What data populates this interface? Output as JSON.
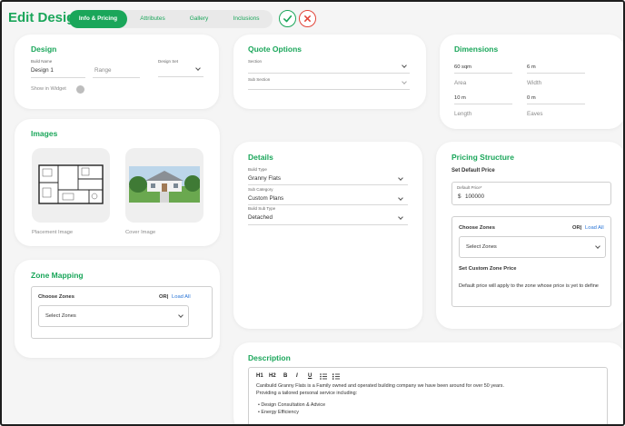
{
  "header": {
    "title": "Edit Design",
    "tabs": [
      "Info & Pricing",
      "Attributes",
      "Gallery",
      "Inclusions"
    ],
    "active_tab": 0
  },
  "design": {
    "title": "Design",
    "build_name_label": "Build Name",
    "build_name_value": "Design 1",
    "range_placeholder": "Range",
    "design_set_label": "Design Set",
    "show_in_widget_label": "Show in Widget"
  },
  "quote_options": {
    "title": "Quote Options",
    "section_placeholder": "Section",
    "sub_section_placeholder": "Sub Section"
  },
  "dimensions": {
    "title": "Dimensions",
    "area_value": "60 sqm",
    "area_label": "Area",
    "width_value": "6 m",
    "width_label": "Width",
    "length_value": "10 m",
    "length_label": "Length",
    "eaves_value": "0 m",
    "eaves_label": "Eaves"
  },
  "images": {
    "title": "Images",
    "placement_label": "Placement Image",
    "cover_label": "Cover Image"
  },
  "details": {
    "title": "Details",
    "build_type_label": "Build Type",
    "build_type_value": "Granny Flats",
    "sub_category_label": "Sub Category",
    "sub_category_value": "Custom Plans",
    "build_sub_type_label": "Build Sub Type",
    "build_sub_type_value": "Detached"
  },
  "pricing": {
    "title": "Pricing Structure",
    "set_default_label": "Set Default Price",
    "default_price_label": "Default Price*",
    "currency": "$",
    "default_price_value": "100000",
    "choose_zones_label": "Choose Zones",
    "or_label": "OR|",
    "load_all_label": "Load All",
    "select_zones_placeholder": "Select Zones",
    "set_custom_label": "Set Custom Zone Price",
    "note": "Default price will apply to the zone whose price is yet to define"
  },
  "zone_mapping": {
    "title": "Zone Mapping",
    "choose_zones_label": "Choose Zones",
    "or_label": "OR|",
    "load_all_label": "Load All",
    "select_zones_placeholder": "Select Zones"
  },
  "description": {
    "title": "Description",
    "toolbar": [
      "H1",
      "H2",
      "B",
      "I",
      "U"
    ],
    "paragraph1": "Canibuild Granny Flats is a Family owned and operated building company we have been around for over 50 years.",
    "paragraph2": "Providing a tailored personal service including:",
    "bullets": [
      "Design Consultation & Advice",
      "Energy Efficiency"
    ]
  },
  "colors": {
    "accent": "#1aa65a",
    "danger": "#e2453a",
    "link": "#2a75d6"
  }
}
